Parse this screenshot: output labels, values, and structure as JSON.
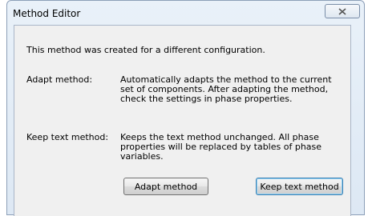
{
  "window": {
    "title": "Method Editor",
    "close_icon": "close-x-icon"
  },
  "message": "This method was created for a different configuration.",
  "options": [
    {
      "label": "Adapt method:",
      "description": "Automatically adapts the method to the current set of components. After adapting the method, check the settings in phase properties."
    },
    {
      "label": "Keep text method:",
      "description": "Keeps the text method unchanged. All phase properties will be replaced by tables of phase variables."
    }
  ],
  "buttons": {
    "adapt": "Adapt method",
    "keep": "Keep text method"
  }
}
